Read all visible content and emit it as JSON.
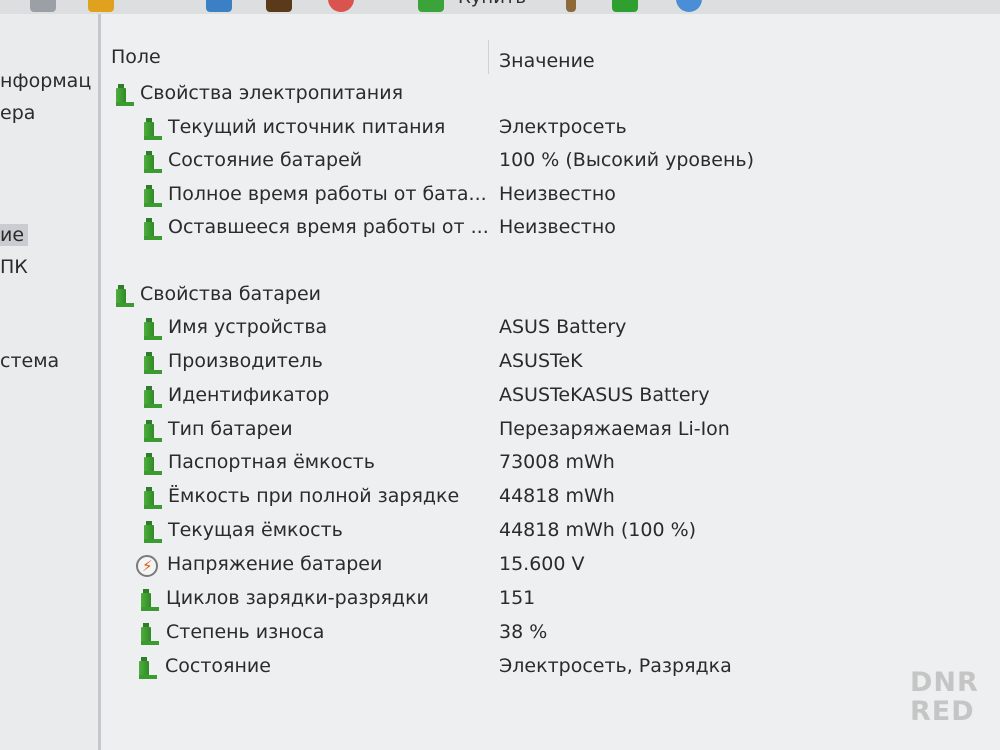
{
  "toolbar": {
    "buy_label": "Купить"
  },
  "left_pane": {
    "items": [
      "нформац",
      "ера",
      "ие",
      "ПК",
      "стема"
    ]
  },
  "columns": {
    "field": "Поле",
    "value": "Значение"
  },
  "groups": [
    {
      "title": "Свойства электропитания",
      "rows": [
        {
          "field": "Текущий источник питания",
          "value": "Электросеть",
          "icon": "battery-icon"
        },
        {
          "field": "Состояние батарей",
          "value": "100 % (Высокий уровень)",
          "icon": "battery-icon"
        },
        {
          "field": "Полное время работы от бата...",
          "value": "Неизвестно",
          "icon": "battery-icon"
        },
        {
          "field": "Оставшееся время работы от ...",
          "value": "Неизвестно",
          "icon": "battery-icon"
        }
      ]
    },
    {
      "title": "Свойства батареи",
      "rows": [
        {
          "field": "Имя устройства",
          "value": "ASUS Battery",
          "icon": "battery-icon"
        },
        {
          "field": "Производитель",
          "value": "ASUSTeK",
          "icon": "battery-icon"
        },
        {
          "field": "Идентификатор",
          "value": "ASUSTeKASUS Battery",
          "icon": "battery-icon"
        },
        {
          "field": "Тип батареи",
          "value": "Перезаряжаемая Li-Ion",
          "icon": "battery-icon"
        },
        {
          "field": "Паспортная ёмкость",
          "value": "73008 mWh",
          "icon": "battery-icon"
        },
        {
          "field": "Ёмкость при полной зарядке",
          "value": "44818 mWh",
          "icon": "battery-icon"
        },
        {
          "field": "Текущая ёмкость",
          "value": "44818 mWh  (100 %)",
          "icon": "battery-icon"
        },
        {
          "field": "Напряжение батареи",
          "value": "15.600 V",
          "icon": "voltage-icon"
        },
        {
          "field": "Циклов зарядки-разрядки",
          "value": "151",
          "icon": "battery-icon"
        },
        {
          "field": "Степень износа",
          "value": "38 %",
          "icon": "battery-icon"
        },
        {
          "field": "Состояние",
          "value": "Электросеть, Разрядка",
          "icon": "battery-icon"
        }
      ]
    }
  ],
  "watermark": {
    "line1": "DNR",
    "line2": "RED"
  }
}
